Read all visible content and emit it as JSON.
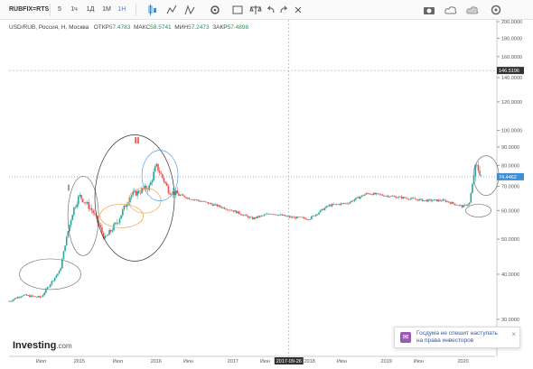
{
  "toolbar": {
    "symbol": "RUBFIX=RTS",
    "timeframes": [
      "5",
      "1ч",
      "1Д",
      "1Н",
      "1М"
    ],
    "icons": [
      "candles-icon",
      "indicator-icon",
      "compare-icon",
      "settings-icon",
      "fullscreen-icon",
      "template-icon",
      "draw-icon",
      "balance-icon",
      "undo-icon",
      "redo-icon",
      "cross-icon",
      "camera-icon",
      "cloud-icon",
      "cloud-down-icon",
      "settings-right-icon"
    ]
  },
  "info": {
    "name": "USD/RUB, Россия, Н, Москва",
    "open_label": "ОТКР",
    "open": "57.4783",
    "high_label": "МАКС",
    "high": "58.5741",
    "low_label": "МИН",
    "low": "57.2473",
    "close_label": "ЗАКР",
    "close": "57.4898"
  },
  "logo": {
    "brand": "Investing",
    "suffix": ".com"
  },
  "toast": {
    "text_line1": "Госдума не спешит наступать",
    "text_line2": "на права инвесторов",
    "close": "×"
  },
  "annotations": {
    "label_i": "I",
    "label_ii": "II"
  },
  "price_axis": {
    "ticks": [
      "200.0000",
      "180.0000",
      "160.0000",
      "140.0000",
      "120.0000",
      "100.0000",
      "90.0000",
      "80.0000",
      "70.0000",
      "60.0000",
      "50.0000",
      "40.0000",
      "30.0000"
    ],
    "current_price": "74.4462",
    "crosshair_price": "146.5196"
  },
  "time_axis": {
    "labels": [
      "Июл",
      "2015",
      "Июл",
      "2016",
      "Июн",
      "2017",
      "Июн",
      "2017-09-26",
      "2018",
      "Июн",
      "2019",
      "Июн",
      "2020"
    ]
  },
  "colors": {
    "up": "#26a69a",
    "down": "#ef5350",
    "price_line": "#3d8fd6",
    "annotation_red": "#e53935",
    "circle_blue": "#5aa0e0",
    "circle_orange": "#f0a050"
  },
  "chart_data": {
    "type": "line",
    "title": "USD/RUB, Россия, Н, Москва",
    "xlabel": "",
    "ylabel": "",
    "y_scale": "log",
    "ylim": [
      30,
      200
    ],
    "x": [
      "2014-01",
      "2014-04",
      "2014-07",
      "2014-10",
      "2014-12",
      "2015-01",
      "2015-03",
      "2015-05",
      "2015-07",
      "2015-09",
      "2015-12",
      "2016-01",
      "2016-03",
      "2016-06",
      "2016-09",
      "2017-01",
      "2017-04",
      "2017-07",
      "2017-10",
      "2018-01",
      "2018-04",
      "2018-07",
      "2018-10",
      "2019-01",
      "2019-04",
      "2019-07",
      "2019-10",
      "2020-01",
      "2020-02",
      "2020-03",
      "2020-04"
    ],
    "series": [
      {
        "values": [
          33,
          35,
          34.5,
          41,
          60,
          66,
          60,
          50,
          56,
          66,
          70,
          80,
          68,
          65,
          63,
          60,
          57,
          59,
          57.5,
          57,
          62,
          63,
          67,
          66,
          65,
          64,
          64,
          61.5,
          63,
          80,
          74.4
        ]
      }
    ]
  }
}
